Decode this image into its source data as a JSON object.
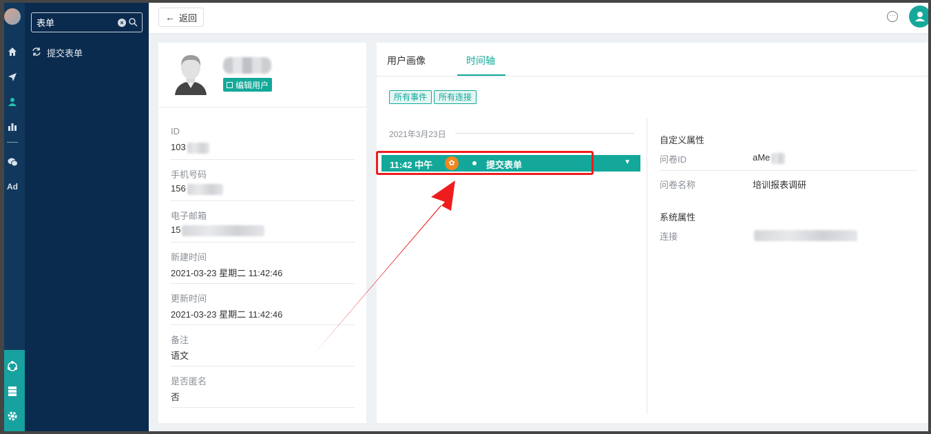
{
  "rail": {
    "nav_icons": [
      "home-icon",
      "send-icon",
      "user-icon",
      "bar-chart-icon",
      "wechat-icon"
    ],
    "ad_label": "Ad",
    "bottom_icons": [
      "network-icon",
      "server-icon",
      "settings-gear-icon"
    ]
  },
  "sidebar": {
    "search": {
      "value": "表单"
    },
    "items": [
      {
        "icon": "refresh-icon",
        "label": "提交表单"
      }
    ]
  },
  "topbar": {
    "back_label": "返回"
  },
  "profile": {
    "edit_label": "编辑用户",
    "fields": [
      {
        "label": "ID",
        "value": "103"
      },
      {
        "label": "手机号码",
        "value": "156"
      },
      {
        "label": "电子邮箱",
        "value": "15"
      },
      {
        "label": "新建时间",
        "value": "2021-03-23 星期二 11:42:46"
      },
      {
        "label": "更新时间",
        "value": "2021-03-23 星期二 11:42:46"
      },
      {
        "label": "备注",
        "value": "语文"
      },
      {
        "label": "是否匿名",
        "value": "否"
      }
    ]
  },
  "main": {
    "tabs": [
      {
        "label": "用户画像",
        "active": false
      },
      {
        "label": "时间轴",
        "active": true
      }
    ],
    "filters": [
      "所有事件",
      "所有连接"
    ],
    "timeline": {
      "date": "2021年3月23日",
      "event": {
        "time": "11:42 中午",
        "name": "提交表单"
      }
    },
    "details": {
      "custom_title": "自定义属性",
      "custom": [
        {
          "label": "问卷ID",
          "value": "aMe"
        },
        {
          "label": "问卷名称",
          "value": "培训报表调研"
        }
      ],
      "system_title": "系统属性",
      "system": [
        {
          "label": "连接",
          "value": ""
        }
      ]
    }
  },
  "colors": {
    "accent": "#13a89a",
    "rail": "#11385c",
    "sidebar": "#0b2b4e",
    "annotation": "#ee1c1c"
  }
}
